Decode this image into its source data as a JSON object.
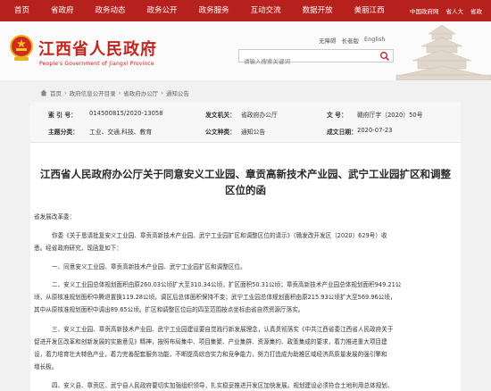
{
  "topnav": {
    "items": [
      "首页",
      "省政府",
      "政务动态",
      "政务公开",
      "政务服务",
      "互动交流",
      "数据开放",
      "美丽江西"
    ],
    "right_links": [
      "中国政府网",
      "省人大",
      "省政"
    ]
  },
  "header": {
    "title": "江西省人民政府",
    "subtitle": "People's Government of Jiangxi Province",
    "tools": [
      "无障碍",
      "长者版",
      "English"
    ],
    "search_placeholder": "请输入搜索关键词"
  },
  "breadcrumb": {
    "items": [
      "首页",
      "政府信息公开目录",
      "省政府办公厅",
      "通知公告"
    ]
  },
  "meta": {
    "index_label": "索  引  号：",
    "index_value": "014500815/2020-13058",
    "issuer_label": "发文机关：",
    "issuer_value": "省政府办公厅",
    "docno_label": "文      号：",
    "docno_value": "赣府厅字〔2020〕50号",
    "topic_label": "主题分类：",
    "topic_value": "工业、交通,科技、教育",
    "genre_label": "公文种类：",
    "genre_value": "通知公告",
    "date_label": "成文日期：",
    "date_value": "2020-07-23"
  },
  "document": {
    "title_line1": "江西省人民政府办公厅关于同意安义工业园、章贡高新技术产业园、武宁工业园扩区和调整",
    "title_line2": "区位的函",
    "salutation": "省发展改革委：",
    "p1": "你委《关于恳请批复安义工业园、章贡高新技术产业园、武宁工业园扩区和调整区位的请示》（赣发改开发区〔2020〕629号）收",
    "p1b": "悉。经省政府研究，现函复如下：",
    "p2": "一、同意安义工业园、章贡高新技术产业园、武宁工业园扩区和调整区位。",
    "p3a": "二、安义工业园总体规划面积由原260.03公顷扩大至310.34公顷，扩区面积50.31公顷；章贡高新技术产业园总体规划面积949.21公",
    "p3b": "顷，从原核准规划面积中腾退置换119.28公顷，调区后总体面积保持不变；武宁工业园总体规划面积由原215.93公顷扩大至569.96公顷，",
    "p3c": "其中从原核准规划面积中调出89.65公顷。扩区和调整区位后的四至范围按点坐标由省自然资源厅落实。",
    "p4a": "三、安义工业园、章贡高新技术产业园、武宁工业园建设要自觉践行新发展理念，认真贯彻落实《中共江西省委江西省人民政府关于",
    "p4b": "促进开发区改革和创新发展的实施意见》精神，按照布局集中、项目集聚、产业集群、资源集约、政策集成的要求，着力推进重大项目建",
    "p4c": "设，着力培育壮大特色产业，着力完善配套服务功能，不断提高综合实力和竞争能力，努力打造成为助推区域经济高质量发展的强引擎和",
    "p4d": "增长极。",
    "p5": "四、安义县、章贡区、武宁县人民政府要切实加强组织领导，扎实稳妥推进开发区加快发展。规划建设必须符合土地利用总体规划、"
  }
}
